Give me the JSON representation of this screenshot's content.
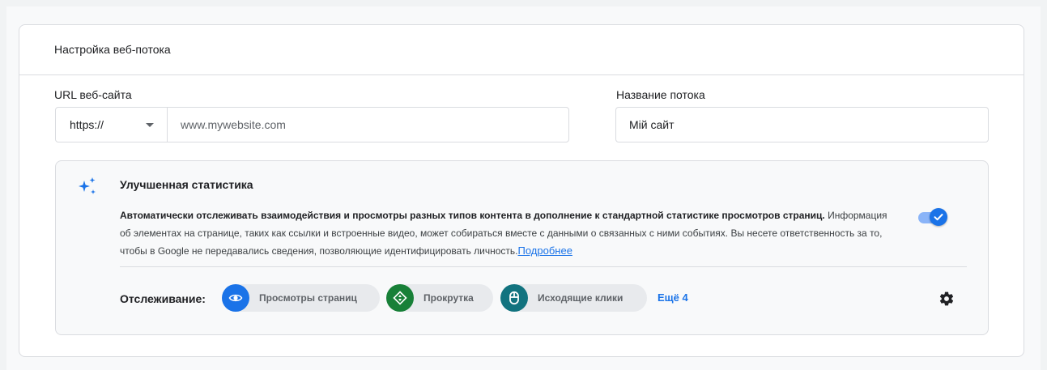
{
  "card": {
    "title": "Настройка веб-потока"
  },
  "url_field": {
    "label": "URL веб-сайта",
    "protocol": "https://",
    "placeholder": "www.mywebsite.com",
    "value": ""
  },
  "name_field": {
    "label": "Название потока",
    "value": "Мій сайт"
  },
  "enhanced": {
    "title": "Улучшенная статистика",
    "desc_bold": "Автоматически отслеживать взаимодействия и просмотры разных типов контента в дополнение к стандартной статистике просмотров страниц.",
    "desc_rest": " Информация об элементах на странице, таких как ссылки и встроенные видео, может собираться вместе с данными о связанных с ними событиях. Вы несете ответственность за то, чтобы в Google не передавались сведения, позволяющие идентифицировать личность.",
    "learn_more": "Подробнее",
    "toggle_on": true,
    "tracking_label": "Отслеживание:",
    "chips": [
      {
        "label": "Просмотры страниц",
        "icon": "eye-icon",
        "color": "#1a73e8"
      },
      {
        "label": "Прокрутка",
        "icon": "scroll-arrows-icon",
        "color": "#188038"
      },
      {
        "label": "Исходящие клики",
        "icon": "mouse-icon",
        "color": "#12737f"
      }
    ],
    "more": "Ещё 4"
  },
  "colors": {
    "accent": "#1a73e8",
    "accent_light": "#8ab4f8"
  }
}
